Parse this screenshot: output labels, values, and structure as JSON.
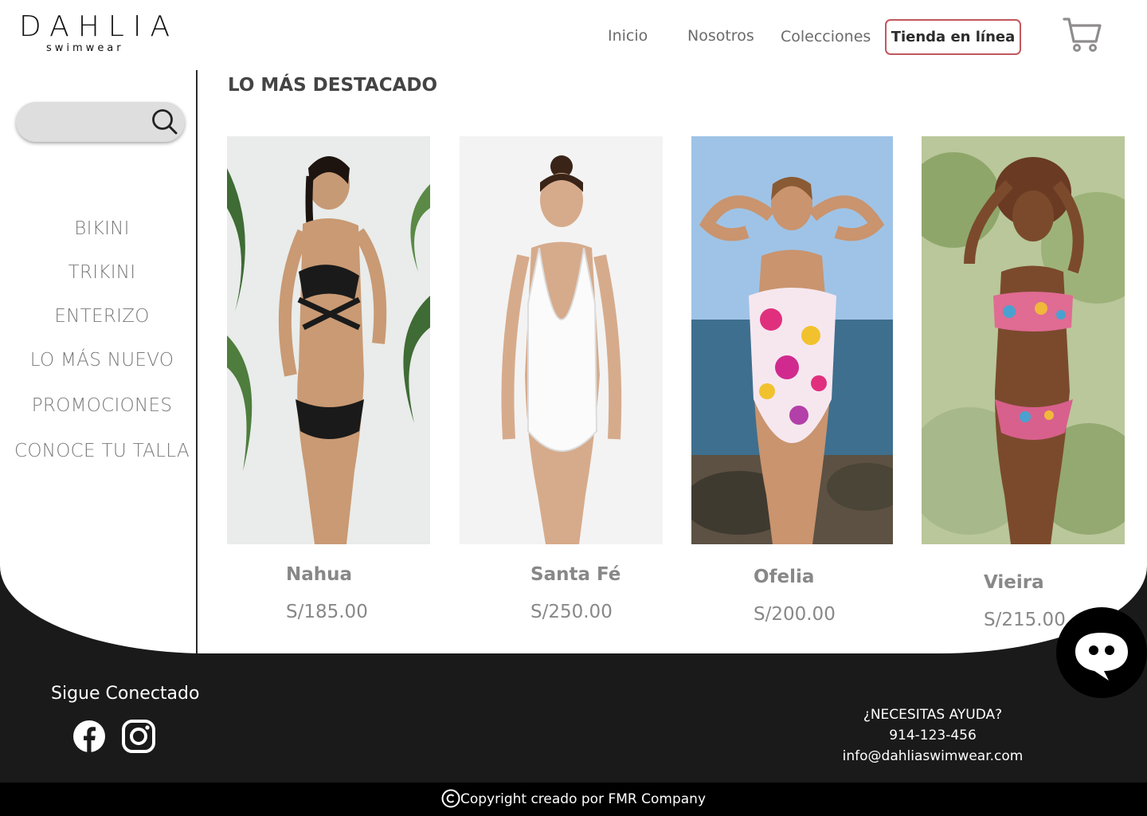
{
  "brand": {
    "name": "DAHLIA",
    "tagline": "swimwear"
  },
  "nav": {
    "items": [
      "Inicio",
      "Nosotros",
      "Colecciones"
    ],
    "active": "Tienda en línea",
    "cart_icon": "cart-icon"
  },
  "search": {
    "placeholder": "",
    "icon": "search-icon"
  },
  "sidebar": {
    "items": [
      "BIKINI",
      "TRIKINI",
      "ENTERIZO",
      "LO MÁS NUEVO",
      "PROMOCIONES",
      "CONOCE TU TALLA"
    ]
  },
  "main": {
    "title": "LO MÁS DESTACADO",
    "products": [
      {
        "name": "Nahua",
        "price": "S/185.00"
      },
      {
        "name": "Santa Fé",
        "price": "S/250.00"
      },
      {
        "name": "Ofelia",
        "price": "S/200.00"
      },
      {
        "name": "Vieira",
        "price": "S/215.00"
      }
    ]
  },
  "footer": {
    "follow_title": "Sigue Conectado",
    "social_icons": [
      "facebook-icon",
      "instagram-icon"
    ],
    "help_title": "¿NECESITAS AYUDA?",
    "phone": "914-123-456",
    "email": "info@dahliaswimwear.com",
    "copyright": "Copyright creado por FMR Company"
  },
  "colors": {
    "accent": "#c2575c",
    "footer_bg": "#1b1a1b",
    "text_gray": "#7a7a7a"
  }
}
